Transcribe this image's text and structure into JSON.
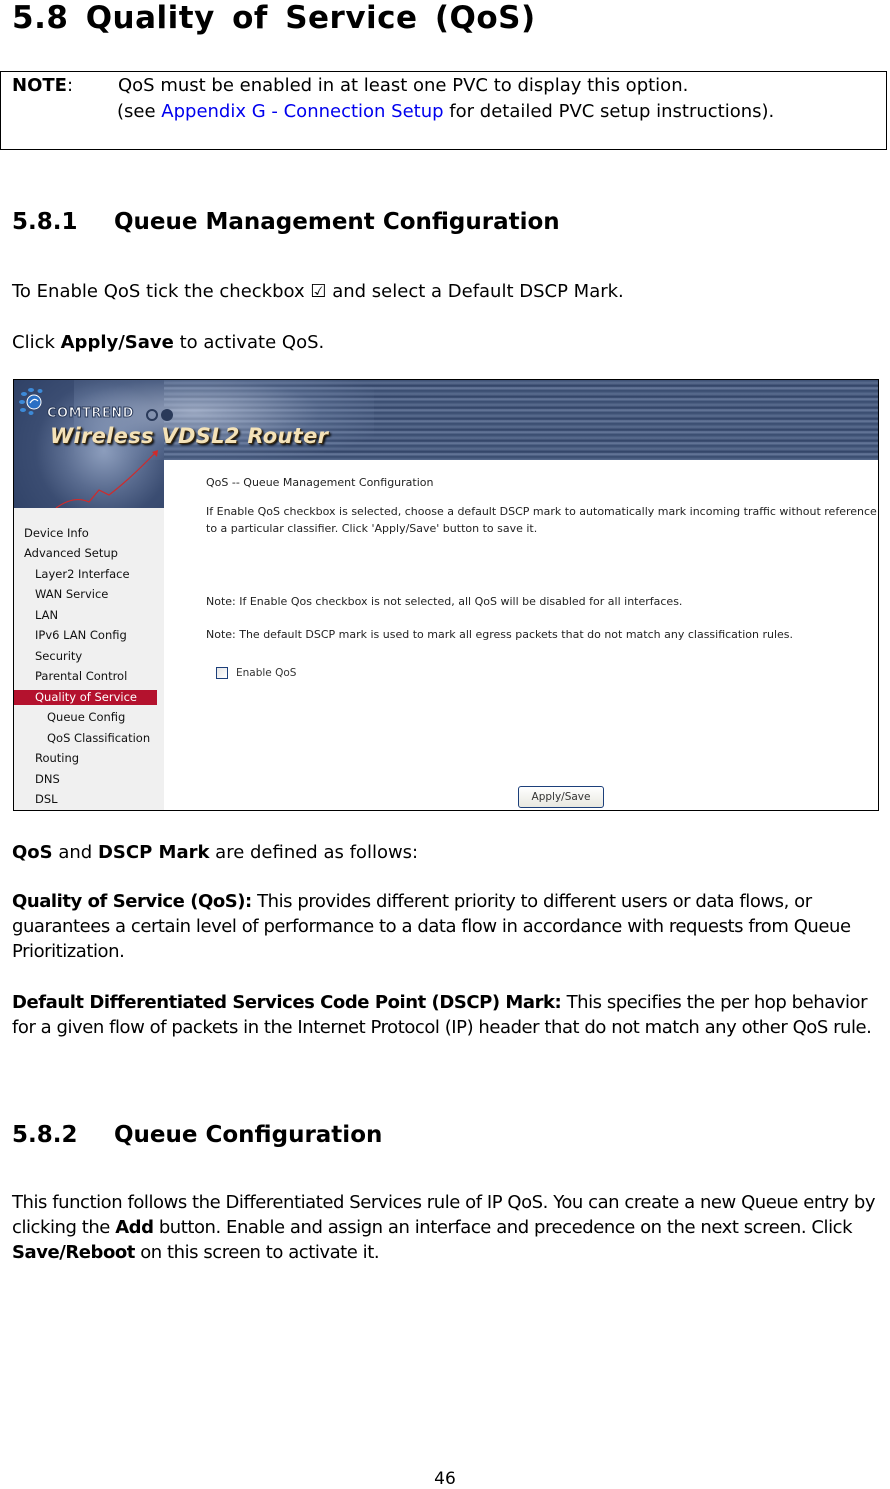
{
  "page": {
    "section_title": "5.8 Quality of Service (QoS)",
    "note": {
      "label": "NOTE",
      "colon": ":",
      "line1": "QoS must be enabled in at least one PVC to display this option.",
      "line2_prefix": "(see ",
      "line2_link": "Appendix G - Connection Setup",
      "line2_suffix": " for detailed PVC setup instructions).",
      "link_color": "#0000ee"
    },
    "subsection1": {
      "number": "5.8.1",
      "title": "Queue Management Configuration",
      "para1": "To Enable QoS tick the checkbox ☑ and select a Default DSCP Mark.",
      "para2_prefix": "Click ",
      "para2_bold": "Apply/Save",
      "para2_suffix": " to activate QoS."
    },
    "definitions": {
      "intro_bold1": "QoS",
      "intro_mid": " and ",
      "intro_bold2": "DSCP Mark",
      "intro_suffix": " are defined as follows:",
      "qos_term": "Quality of Service (QoS):",
      "qos_text": " This provides different priority to different users or data flows, or guarantees a certain level of performance to a data flow in accordance with requests from Queue Prioritization.",
      "dscp_term": "Default Differentiated Services Code Point (DSCP) Mark:",
      "dscp_text": " This specifies the per hop behavior for a given flow of packets in the Internet Protocol (IP) header that do not match any other QoS rule."
    },
    "subsection2": {
      "number": "5.8.2",
      "title": "Queue Configuration",
      "para_prefix": "This function follows the Differentiated Services rule of IP QoS. You can create a new Queue entry by clicking the ",
      "para_bold1": "Add",
      "para_mid": " button. Enable and assign an interface and precedence on the next screen. Click ",
      "para_bold2": "Save/Reboot",
      "para_suffix": " on this screen to activate it."
    },
    "page_number": "46"
  },
  "router_ui": {
    "brand": "COMTREND",
    "product": "Wireless VDSL2 Router",
    "accent_color": "#b4122e",
    "sidebar": {
      "items": [
        {
          "label": "Device Info",
          "level": 0
        },
        {
          "label": "Advanced Setup",
          "level": 0
        },
        {
          "label": "Layer2 Interface",
          "level": 1
        },
        {
          "label": "WAN Service",
          "level": 1
        },
        {
          "label": "LAN",
          "level": 1
        },
        {
          "label": "IPv6 LAN Config",
          "level": 1
        },
        {
          "label": "Security",
          "level": 1
        },
        {
          "label": "Parental Control",
          "level": 1
        },
        {
          "label": "Quality of Service",
          "level": 1,
          "active": true
        },
        {
          "label": "Queue Config",
          "level": 2
        },
        {
          "label": "QoS Classification",
          "level": 2
        },
        {
          "label": "Routing",
          "level": 1
        },
        {
          "label": "DNS",
          "level": 1
        },
        {
          "label": "DSL",
          "level": 1
        }
      ]
    },
    "content": {
      "title": "QoS -- Queue Management Configuration",
      "description": "If Enable QoS checkbox is selected, choose a default DSCP mark to automatically mark incoming traffic without reference to a particular classifier. Click 'Apply/Save' button to save it.",
      "note1": "Note: If Enable Qos checkbox is not selected, all QoS will be disabled for all interfaces.",
      "note2": "Note: The default DSCP mark is used to mark all egress packets that do not match any classification rules.",
      "enable_qos_label": "Enable QoS",
      "enable_qos_checked": false,
      "apply_button": "Apply/Save"
    }
  }
}
